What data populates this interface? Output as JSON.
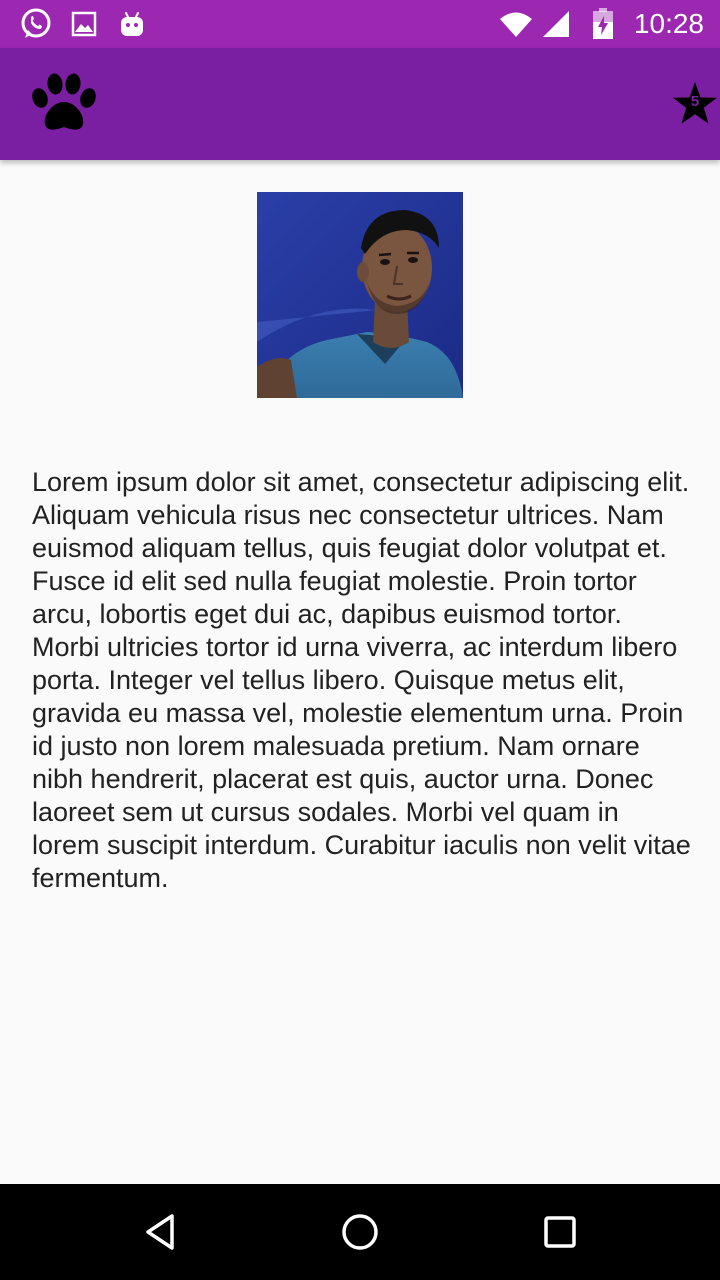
{
  "status_bar": {
    "time": "10:28",
    "icons": [
      "whatsapp-icon",
      "image-icon",
      "android-icon",
      "wifi-icon",
      "signal-icon",
      "battery-icon"
    ],
    "background": "#9c27b0"
  },
  "app_bar": {
    "logo_icon": "paw-icon",
    "star_count": "5",
    "background": "#7b1fa2"
  },
  "content": {
    "photo_alt": "profile-photo",
    "paragraph": "Lorem ipsum dolor sit amet, consectetur adipiscing elit. Aliquam vehicula risus nec consectetur ultrices. Nam euismod aliquam tellus, quis feugiat dolor volutpat et. Fusce id elit sed nulla feugiat molestie. Proin tortor arcu, lobortis eget dui ac, dapibus euismod tortor. Morbi ultricies tortor id urna viverra, ac interdum libero porta. Integer vel tellus libero. Quisque metus elit, gravida eu massa vel, molestie elementum urna. Proin id justo non lorem malesuada pretium. Nam ornare nibh hendrerit, placerat est quis, auctor urna. Donec laoreet sem ut cursus sodales. Morbi vel quam in lorem suscipit interdum. Curabitur iaculis non velit vitae fermentum."
  },
  "nav_bar": {
    "buttons": [
      "back-icon",
      "home-icon",
      "recents-icon"
    ]
  }
}
